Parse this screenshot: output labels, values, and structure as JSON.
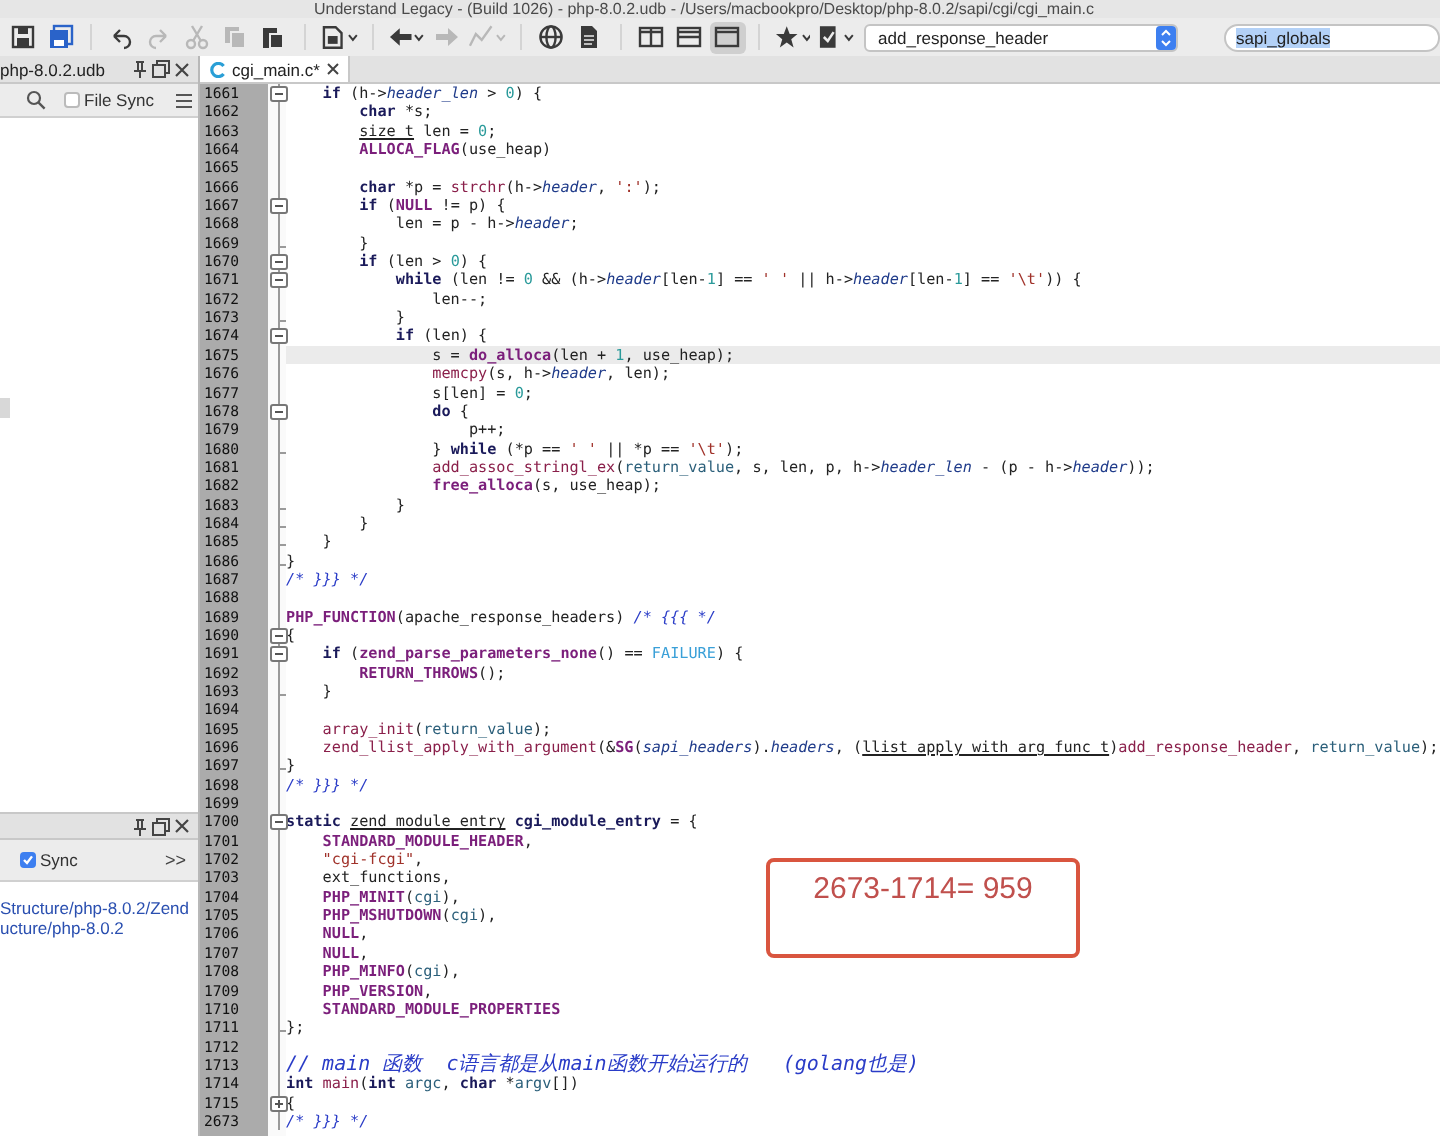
{
  "window": {
    "title": "Understand Legacy - (Build 1026) - php-8.0.2.udb - /Users/macbookpro/Desktop/php-8.0.2/sapi/cgi/cgi_main.c"
  },
  "toolbar": {
    "buttons": [
      {
        "kind": "save",
        "disabled": false,
        "pressed": false,
        "dropdown": false
      },
      {
        "kind": "save-all",
        "disabled": false,
        "pressed": false,
        "dropdown": false
      },
      {
        "kind": "separator"
      },
      {
        "kind": "undo",
        "disabled": false,
        "pressed": false,
        "dropdown": false
      },
      {
        "kind": "redo",
        "disabled": true,
        "pressed": false,
        "dropdown": false
      },
      {
        "kind": "cut",
        "disabled": true,
        "pressed": false,
        "dropdown": false
      },
      {
        "kind": "copy",
        "disabled": true,
        "pressed": false,
        "dropdown": false
      },
      {
        "kind": "paste",
        "disabled": false,
        "pressed": false,
        "dropdown": false
      },
      {
        "kind": "separator"
      },
      {
        "kind": "document",
        "disabled": false,
        "pressed": false,
        "dropdown": true
      },
      {
        "kind": "separator"
      },
      {
        "kind": "back",
        "disabled": false,
        "pressed": false,
        "dropdown": true
      },
      {
        "kind": "forward",
        "disabled": true,
        "pressed": false,
        "dropdown": false
      },
      {
        "kind": "graph",
        "disabled": true,
        "pressed": false,
        "dropdown": true
      },
      {
        "kind": "separator"
      },
      {
        "kind": "globe",
        "disabled": false,
        "pressed": false,
        "dropdown": false
      },
      {
        "kind": "file",
        "disabled": false,
        "pressed": false,
        "dropdown": false
      },
      {
        "kind": "separator"
      },
      {
        "kind": "layout-columns",
        "disabled": false,
        "pressed": false,
        "dropdown": false
      },
      {
        "kind": "layout-rows",
        "disabled": false,
        "pressed": false,
        "dropdown": false
      },
      {
        "kind": "layout-single",
        "disabled": false,
        "pressed": true,
        "dropdown": false
      },
      {
        "kind": "separator"
      },
      {
        "kind": "star",
        "disabled": false,
        "pressed": false,
        "dropdown": true
      },
      {
        "kind": "checklist",
        "disabled": false,
        "pressed": false,
        "dropdown": true
      }
    ],
    "combo": {
      "value": "add_response_header"
    },
    "search": {
      "value": "sapi_globals",
      "text_selected": true
    }
  },
  "left_panel": {
    "tab": {
      "label": "php-8.0.2.udb"
    },
    "file_sync": {
      "label": "File Sync",
      "checked": false
    }
  },
  "bottom_panel": {
    "sync": {
      "label": "Sync",
      "checked": true
    },
    "overflow": ">>",
    "paths": [
      "Structure/php-8.0.2/Zend",
      "ucture/php-8.0.2"
    ]
  },
  "editor": {
    "tab": {
      "label": "cgi_main.c*"
    },
    "lines": [
      {
        "number": "1661",
        "selected": false,
        "kind": "fold-start",
        "segments": [
          {
            "kind": "kw",
            "text": "    if"
          },
          {
            "text": " (h->"
          },
          {
            "kind": "fld",
            "text": "header_len"
          },
          {
            "text": " > "
          },
          {
            "kind": "num",
            "text": "0"
          },
          {
            "text": ") {"
          }
        ]
      },
      {
        "number": "1662",
        "selected": false,
        "kind": "plain",
        "segments": [
          {
            "kind": "kw",
            "text": "        char"
          },
          {
            "text": " *s;"
          }
        ]
      },
      {
        "number": "1663",
        "selected": false,
        "kind": "plain",
        "segments": [
          {
            "kind": "typ",
            "text": "        size_t"
          },
          {
            "text": " len = "
          },
          {
            "kind": "num",
            "text": "0"
          },
          {
            "text": ";"
          }
        ]
      },
      {
        "number": "1664",
        "selected": false,
        "kind": "plain",
        "segments": [
          {
            "kind": "mac",
            "text": "        ALLOCA_FLAG"
          },
          {
            "text": "(use_heap)"
          }
        ]
      },
      {
        "number": "1665",
        "selected": false,
        "kind": "plain"
      },
      {
        "number": "1666",
        "selected": false,
        "kind": "plain",
        "segments": [
          {
            "kind": "kw",
            "text": "        char"
          },
          {
            "text": " *p = "
          },
          {
            "kind": "fn",
            "text": "strchr"
          },
          {
            "text": "(h->"
          },
          {
            "kind": "fld",
            "text": "header"
          },
          {
            "text": ", "
          },
          {
            "kind": "str",
            "text": "':'"
          },
          {
            "text": ");"
          }
        ]
      },
      {
        "number": "1667",
        "selected": false,
        "kind": "fold-start",
        "segments": [
          {
            "kind": "kw",
            "text": "        if"
          },
          {
            "text": " ("
          },
          {
            "kind": "mac",
            "text": "NULL"
          },
          {
            "text": " != p) {"
          }
        ]
      },
      {
        "number": "1668",
        "selected": false,
        "kind": "plain",
        "segments": [
          {
            "text": "            len = p - h->"
          },
          {
            "kind": "fld",
            "text": "header"
          },
          {
            "text": ";"
          }
        ]
      },
      {
        "number": "1669",
        "selected": false,
        "kind": "fold-end",
        "segments": [
          {
            "text": "        }"
          }
        ]
      },
      {
        "number": "1670",
        "selected": false,
        "kind": "fold-start",
        "segments": [
          {
            "kind": "kw",
            "text": "        if"
          },
          {
            "text": " (len > "
          },
          {
            "kind": "num",
            "text": "0"
          },
          {
            "text": ") {"
          }
        ]
      },
      {
        "number": "1671",
        "selected": false,
        "kind": "fold-start",
        "segments": [
          {
            "kind": "kw",
            "text": "            while"
          },
          {
            "text": " (len != "
          },
          {
            "kind": "num",
            "text": "0"
          },
          {
            "text": " && (h->"
          },
          {
            "kind": "fld",
            "text": "header"
          },
          {
            "text": "[len-"
          },
          {
            "kind": "num",
            "text": "1"
          },
          {
            "text": "] == "
          },
          {
            "kind": "str",
            "text": "' '"
          },
          {
            "text": " || h->"
          },
          {
            "kind": "fld",
            "text": "header"
          },
          {
            "text": "[len-"
          },
          {
            "kind": "num",
            "text": "1"
          },
          {
            "text": "] == "
          },
          {
            "kind": "str",
            "text": "'\\t'"
          },
          {
            "text": ")) {"
          }
        ]
      },
      {
        "number": "1672",
        "selected": false,
        "kind": "plain",
        "segments": [
          {
            "text": "                len--;"
          }
        ]
      },
      {
        "number": "1673",
        "selected": false,
        "kind": "fold-end",
        "segments": [
          {
            "text": "            }"
          }
        ]
      },
      {
        "number": "1674",
        "selected": false,
        "kind": "fold-start",
        "segments": [
          {
            "kind": "kw",
            "text": "            if"
          },
          {
            "text": " (len) {"
          }
        ]
      },
      {
        "number": "1675",
        "selected": true,
        "kind": "plain",
        "segments": [
          {
            "text": "                s = "
          },
          {
            "kind": "mac",
            "text": "do_alloca"
          },
          {
            "text": "(len + "
          },
          {
            "kind": "num",
            "text": "1"
          },
          {
            "text": ", use_heap);"
          }
        ]
      },
      {
        "number": "1676",
        "selected": false,
        "kind": "plain",
        "segments": [
          {
            "kind": "fn",
            "text": "                memcpy"
          },
          {
            "text": "(s, h->"
          },
          {
            "kind": "fld",
            "text": "header"
          },
          {
            "text": ", len);"
          }
        ]
      },
      {
        "number": "1677",
        "selected": false,
        "kind": "plain",
        "segments": [
          {
            "text": "                s[len] = "
          },
          {
            "kind": "num",
            "text": "0"
          },
          {
            "text": ";"
          }
        ]
      },
      {
        "number": "1678",
        "selected": false,
        "kind": "fold-start",
        "segments": [
          {
            "kind": "kw",
            "text": "                do"
          },
          {
            "text": " {"
          }
        ]
      },
      {
        "number": "1679",
        "selected": false,
        "kind": "plain",
        "segments": [
          {
            "text": "                    p++;"
          }
        ]
      },
      {
        "number": "1680",
        "selected": false,
        "kind": "fold-end",
        "segments": [
          {
            "text": "                } "
          },
          {
            "kind": "kw",
            "text": "while"
          },
          {
            "text": " (*p == "
          },
          {
            "kind": "str",
            "text": "' '"
          },
          {
            "text": " || *p == "
          },
          {
            "kind": "str",
            "text": "'\\t'"
          },
          {
            "text": ");"
          }
        ]
      },
      {
        "number": "1681",
        "selected": false,
        "kind": "plain",
        "segments": [
          {
            "kind": "fn",
            "text": "                add_assoc_stringl_ex"
          },
          {
            "text": "("
          },
          {
            "kind": "var",
            "text": "return_value"
          },
          {
            "text": ", s, len, p, h->"
          },
          {
            "kind": "fld",
            "text": "header_len"
          },
          {
            "text": " - (p - h->"
          },
          {
            "kind": "fld",
            "text": "header"
          },
          {
            "text": "));"
          }
        ]
      },
      {
        "number": "1682",
        "selected": false,
        "kind": "plain",
        "segments": [
          {
            "kind": "mac",
            "text": "                free_alloca"
          },
          {
            "text": "(s, use_heap);"
          }
        ]
      },
      {
        "number": "1683",
        "selected": false,
        "kind": "fold-end",
        "segments": [
          {
            "text": "            }"
          }
        ]
      },
      {
        "number": "1684",
        "selected": false,
        "kind": "fold-end",
        "segments": [
          {
            "text": "        }"
          }
        ]
      },
      {
        "number": "1685",
        "selected": false,
        "kind": "fold-end",
        "segments": [
          {
            "text": "    }"
          }
        ]
      },
      {
        "number": "1686",
        "selected": false,
        "kind": "fold-end",
        "segments": [
          {
            "text": "}"
          }
        ]
      },
      {
        "number": "1687",
        "selected": false,
        "kind": "plain",
        "segments": [
          {
            "kind": "com",
            "text": "/* }}} */"
          }
        ]
      },
      {
        "number": "1688",
        "selected": false,
        "kind": "plain"
      },
      {
        "number": "1689",
        "selected": false,
        "kind": "plain",
        "segments": [
          {
            "kind": "mac",
            "text": "PHP_FUNCTION"
          },
          {
            "text": "(apache_response_headers) "
          },
          {
            "kind": "com",
            "text": "/* {{{ */"
          }
        ]
      },
      {
        "number": "1690",
        "selected": false,
        "kind": "fold-start",
        "segments": [
          {
            "text": "{"
          }
        ]
      },
      {
        "number": "1691",
        "selected": false,
        "kind": "fold-start",
        "segments": [
          {
            "kind": "kw",
            "text": "    if"
          },
          {
            "text": " ("
          },
          {
            "kind": "mac",
            "text": "zend_parse_parameters_none"
          },
          {
            "text": "() == "
          },
          {
            "kind": "con",
            "text": "FAILURE"
          },
          {
            "text": ") {"
          }
        ]
      },
      {
        "number": "1692",
        "selected": false,
        "kind": "plain",
        "segments": [
          {
            "kind": "mac",
            "text": "        RETURN_THROWS"
          },
          {
            "text": "();"
          }
        ]
      },
      {
        "number": "1693",
        "selected": false,
        "kind": "fold-end",
        "segments": [
          {
            "text": "    }"
          }
        ]
      },
      {
        "number": "1694",
        "selected": false,
        "kind": "plain"
      },
      {
        "number": "1695",
        "selected": false,
        "kind": "plain",
        "segments": [
          {
            "kind": "fn",
            "text": "    array_init"
          },
          {
            "text": "("
          },
          {
            "kind": "var",
            "text": "return_value"
          },
          {
            "text": ");"
          }
        ]
      },
      {
        "number": "1696",
        "selected": false,
        "kind": "plain",
        "segments": [
          {
            "kind": "fn",
            "text": "    zend_llist_apply_with_argument"
          },
          {
            "text": "(&"
          },
          {
            "kind": "mac",
            "text": "SG"
          },
          {
            "text": "("
          },
          {
            "kind": "fld",
            "text": "sapi_headers"
          },
          {
            "text": ")."
          },
          {
            "kind": "fld",
            "text": "headers"
          },
          {
            "text": ", ("
          },
          {
            "kind": "typ",
            "text": "llist_apply_with_arg_func_t"
          },
          {
            "text": ")"
          },
          {
            "kind": "fn",
            "text": "add_response_header"
          },
          {
            "text": ", "
          },
          {
            "kind": "var",
            "text": "return_value"
          },
          {
            "text": ");"
          }
        ]
      },
      {
        "number": "1697",
        "selected": false,
        "kind": "fold-end",
        "segments": [
          {
            "text": "}"
          }
        ]
      },
      {
        "number": "1698",
        "selected": false,
        "kind": "plain",
        "segments": [
          {
            "kind": "com",
            "text": "/* }}} */"
          }
        ]
      },
      {
        "number": "1699",
        "selected": false,
        "kind": "plain"
      },
      {
        "number": "1700",
        "selected": false,
        "kind": "fold-start",
        "segments": [
          {
            "kind": "kw",
            "text": "static"
          },
          {
            "kind": "typ",
            "text": " zend_module_entry"
          },
          {
            "kind": "kw",
            "text": " cgi_module_entry"
          },
          {
            "text": " = {"
          }
        ]
      },
      {
        "number": "1701",
        "selected": false,
        "kind": "plain",
        "segments": [
          {
            "kind": "mac",
            "text": "    STANDARD_MODULE_HEADER"
          },
          {
            "text": ","
          }
        ]
      },
      {
        "number": "1702",
        "selected": false,
        "kind": "plain",
        "segments": [
          {
            "kind": "str",
            "text": "    \"cgi-fcgi\""
          },
          {
            "text": ","
          }
        ]
      },
      {
        "number": "1703",
        "selected": false,
        "kind": "plain",
        "segments": [
          {
            "text": "    ext_functions,"
          }
        ]
      },
      {
        "number": "1704",
        "selected": false,
        "kind": "plain",
        "segments": [
          {
            "kind": "mac",
            "text": "    PHP_MINIT"
          },
          {
            "text": "("
          },
          {
            "kind": "var",
            "text": "cgi"
          },
          {
            "text": "),"
          }
        ]
      },
      {
        "number": "1705",
        "selected": false,
        "kind": "plain",
        "segments": [
          {
            "kind": "mac",
            "text": "    PHP_MSHUTDOWN"
          },
          {
            "text": "("
          },
          {
            "kind": "var",
            "text": "cgi"
          },
          {
            "text": "),"
          }
        ]
      },
      {
        "number": "1706",
        "selected": false,
        "kind": "plain",
        "segments": [
          {
            "kind": "mac",
            "text": "    NULL"
          },
          {
            "text": ","
          }
        ]
      },
      {
        "number": "1707",
        "selected": false,
        "kind": "plain",
        "segments": [
          {
            "kind": "mac",
            "text": "    NULL"
          },
          {
            "text": ","
          }
        ]
      },
      {
        "number": "1708",
        "selected": false,
        "kind": "plain",
        "segments": [
          {
            "kind": "mac",
            "text": "    PHP_MINFO"
          },
          {
            "text": "("
          },
          {
            "kind": "var",
            "text": "cgi"
          },
          {
            "text": "),"
          }
        ]
      },
      {
        "number": "1709",
        "selected": false,
        "kind": "plain",
        "segments": [
          {
            "kind": "mac",
            "text": "    PHP_VERSION"
          },
          {
            "text": ","
          }
        ]
      },
      {
        "number": "1710",
        "selected": false,
        "kind": "plain",
        "segments": [
          {
            "kind": "mac",
            "text": "    STANDARD_MODULE_PROPERTIES"
          }
        ]
      },
      {
        "number": "1711",
        "selected": false,
        "kind": "fold-end",
        "segments": [
          {
            "text": "};"
          }
        ]
      },
      {
        "number": "1712",
        "selected": false,
        "kind": "plain"
      },
      {
        "number": "1713",
        "selected": false,
        "kind": "plain",
        "segments": [
          {
            "kind": "com",
            "text": "// main 函数  c语言都是从main函数开始运行的   (golang也是)"
          }
        ]
      },
      {
        "number": "1714",
        "selected": false,
        "kind": "plain",
        "segments": [
          {
            "kind": "kw",
            "text": "int"
          },
          {
            "kind": "fn",
            "text": " main"
          },
          {
            "text": "("
          },
          {
            "kind": "kw",
            "text": "int"
          },
          {
            "kind": "var",
            "text": " argc"
          },
          {
            "text": ", "
          },
          {
            "kind": "kw",
            "text": "char"
          },
          {
            "text": " *"
          },
          {
            "kind": "var",
            "text": "argv"
          },
          {
            "text": "[])"
          }
        ]
      },
      {
        "number": "1715",
        "selected": false,
        "kind": "fold-collapsed",
        "segments": [
          {
            "text": "{"
          }
        ]
      },
      {
        "number": "2673",
        "selected": false,
        "kind": "plain",
        "segments": [
          {
            "kind": "com",
            "text": "/* }}} */"
          }
        ]
      }
    ]
  },
  "annotation": {
    "text": "2673-1714= 959"
  }
}
